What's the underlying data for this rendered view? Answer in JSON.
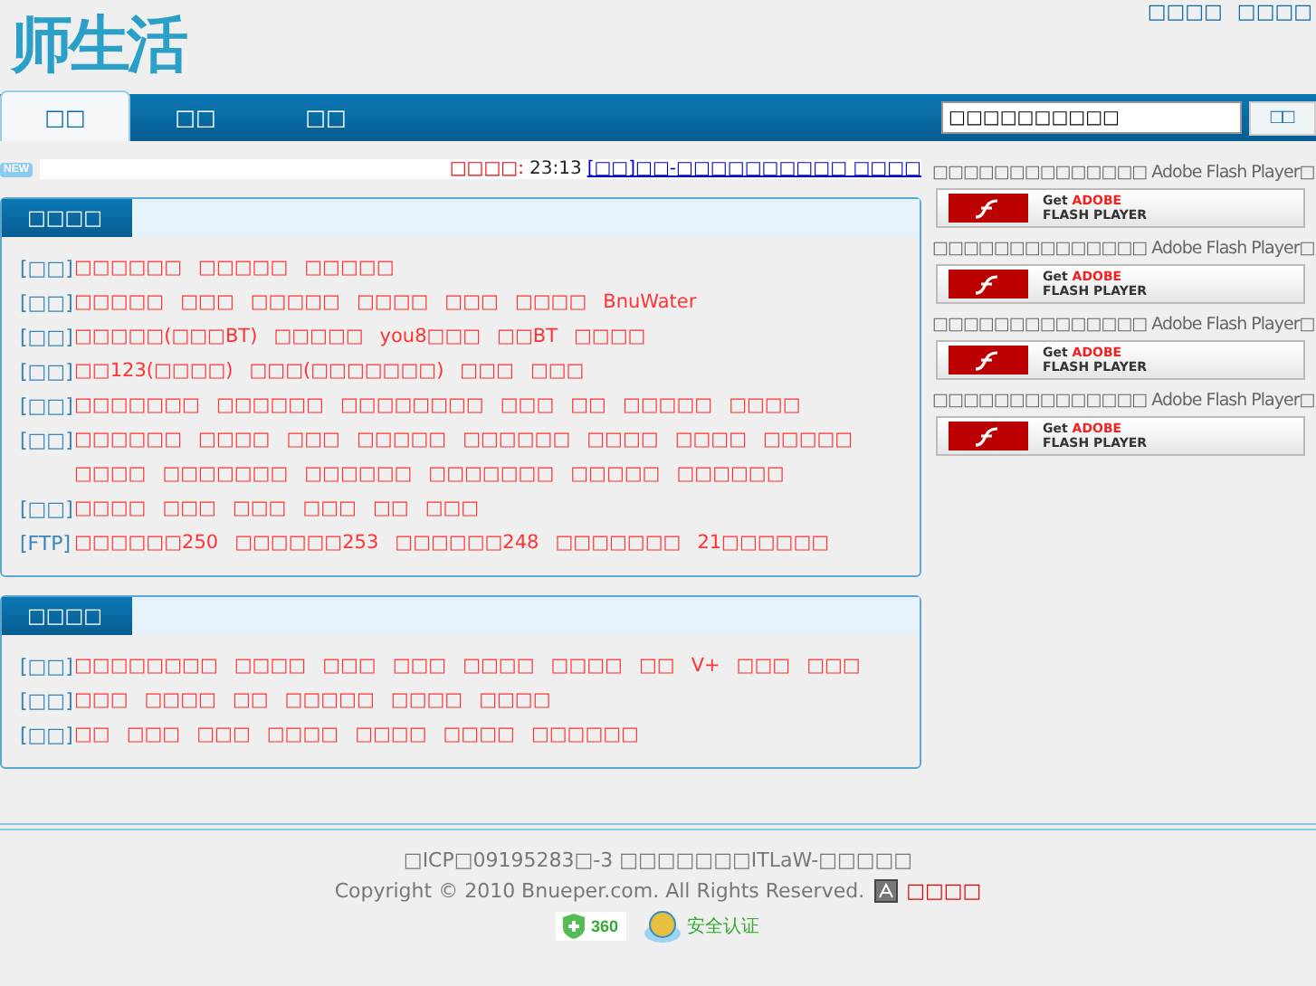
{
  "header": {
    "logo": "师生活",
    "links": [
      "□□□□",
      "□□□□"
    ]
  },
  "nav": {
    "tabs": [
      {
        "label": "□□",
        "selected": true
      },
      {
        "label": "□□",
        "selected": false
      },
      {
        "label": "□□",
        "selected": false
      }
    ],
    "search": {
      "value": "□□□□□□□□□□"
    },
    "search_button": "□□"
  },
  "ticker": {
    "badge": "NEW",
    "label": "□□□□:",
    "time": "23:13",
    "link": "[□□]□□-□□□□□□□□□□ □□□□"
  },
  "panels": [
    {
      "title": "□□□□",
      "rows": [
        {
          "category": "[□□]",
          "links": [
            "□□□□□□",
            "□□□□□",
            "□□□□□"
          ]
        },
        {
          "category": "[□□]",
          "links": [
            "□□□□□",
            "□□□",
            "□□□□□",
            "□□□□",
            "□□□",
            "□□□□",
            "BnuWater"
          ]
        },
        {
          "category": "[□□]",
          "links": [
            "□□□□□(□□□BT)",
            "□□□□□",
            "you8□□□",
            "□□BT",
            "□□□□"
          ]
        },
        {
          "category": "[□□]",
          "links": [
            "□□123(□□□□)",
            "□□□(□□□□□□□)",
            "□□□",
            "□□□"
          ]
        },
        {
          "category": "[□□]",
          "links": [
            "□□□□□□□",
            "□□□□□□",
            "□□□□□□□□",
            "□□□",
            "□□",
            "□□□□□",
            "□□□□"
          ]
        },
        {
          "category": "[□□]",
          "links": [
            "□□□□□□",
            "□□□□",
            "□□□",
            "□□□□□",
            "□□□□□□",
            "□□□□",
            "□□□□",
            "□□□□□",
            "□□□□",
            "□□□□□□□",
            "□□□□□□",
            "□□□□□□□",
            "□□□□□",
            "□□□□□□"
          ]
        },
        {
          "category": "[□□]",
          "links": [
            "□□□□",
            "□□□",
            "□□□",
            "□□□",
            "□□",
            "□□□"
          ]
        },
        {
          "category": "[FTP]",
          "links": [
            "□□□□□□250",
            "□□□□□□253",
            "□□□□□□248",
            "□□□□□□□",
            "21□□□□□□"
          ]
        }
      ]
    },
    {
      "title": "□□□□",
      "rows": [
        {
          "category": "[□□]",
          "links": [
            "□□□□□□□□",
            "□□□□",
            "□□□",
            "□□□",
            "□□□□",
            "□□□□",
            "□□",
            "V+",
            "□□□",
            "□□□"
          ]
        },
        {
          "category": "[□□]",
          "links": [
            "□□□",
            "□□□□",
            "□□",
            "□□□□□",
            "□□□□",
            "□□□□"
          ]
        },
        {
          "category": "[□□]",
          "links": [
            "□□",
            "□□□",
            "□□□",
            "□□□□",
            "□□□□",
            "□□□□",
            "□□□□□□"
          ]
        }
      ]
    }
  ],
  "flash_ads": [
    {
      "text": "□□□□□□□□□□□□□□ Adobe Flash Player□",
      "badge_get": "Get",
      "badge_brand": "ADOBE",
      "badge_product": "FLASH PLAYER"
    },
    {
      "text": "□□□□□□□□□□□□□□ Adobe Flash Player□",
      "badge_get": "Get",
      "badge_brand": "ADOBE",
      "badge_product": "FLASH PLAYER"
    },
    {
      "text": "□□□□□□□□□□□□□□ Adobe Flash Player□",
      "badge_get": "Get",
      "badge_brand": "ADOBE",
      "badge_product": "FLASH PLAYER"
    },
    {
      "text": "□□□□□□□□□□□□□□ Adobe Flash Player□",
      "badge_get": "Get",
      "badge_brand": "ADOBE",
      "badge_product": "FLASH PLAYER"
    }
  ],
  "footer": {
    "icp": "□ICP□09195283□-3 □□□□□□□ITLaW-□□□□□",
    "copyright": "Copyright © 2010 Bnueper.com. All Rights Reserved.",
    "link": "□□□□",
    "badge_360": "360",
    "security": "安全认证"
  }
}
